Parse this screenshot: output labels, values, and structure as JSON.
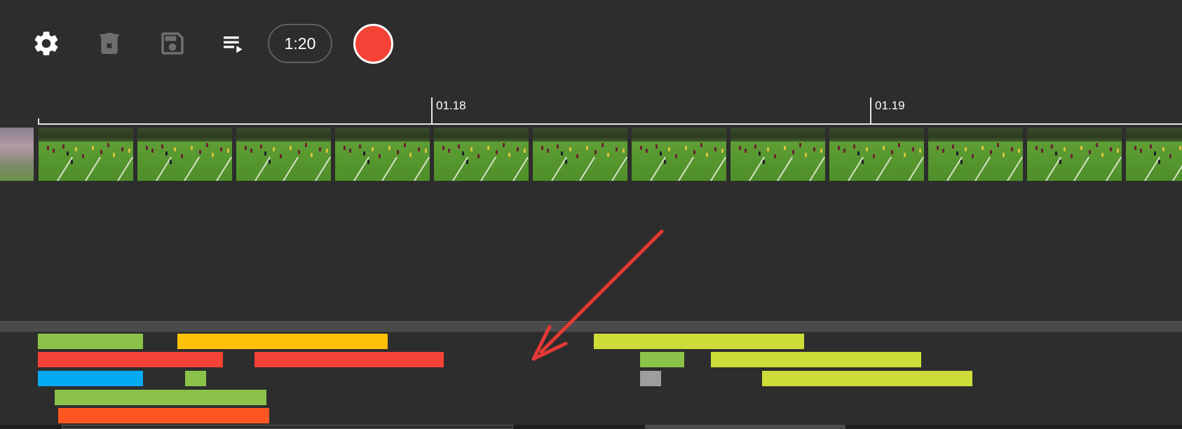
{
  "toolbar": {
    "settings_icon": "gear-icon",
    "delete_icon": "delete-icon",
    "save_icon": "save-icon",
    "playlist_icon": "playlist-play-icon",
    "time_label": "1:20",
    "record_icon": "record-icon"
  },
  "ruler": {
    "ticks": [
      "01.18",
      "01.19"
    ]
  },
  "filmstrip": {
    "frame_count": 12
  },
  "tracks": {
    "rows": [
      [
        {
          "color": "#8bc34a"
        },
        {
          "color": "#ffc107"
        },
        {
          "color": "#cddc39"
        }
      ],
      [
        {
          "color": "#f44336"
        },
        {
          "color": "#f44336"
        },
        {
          "color": "#8bc34a"
        },
        {
          "color": "#cddc39"
        }
      ],
      [
        {
          "color": "#03a9f4"
        },
        {
          "color": "#8bc34a"
        },
        {
          "color": "#9e9e9e"
        },
        {
          "color": "#cddc39"
        }
      ],
      [
        {
          "color": "#8bc34a"
        }
      ],
      [
        {
          "color": "#ff5722"
        }
      ]
    ]
  },
  "colors": {
    "background": "#2d2d2d",
    "record": "#f44336",
    "annotation_arrow": "#e53935"
  }
}
